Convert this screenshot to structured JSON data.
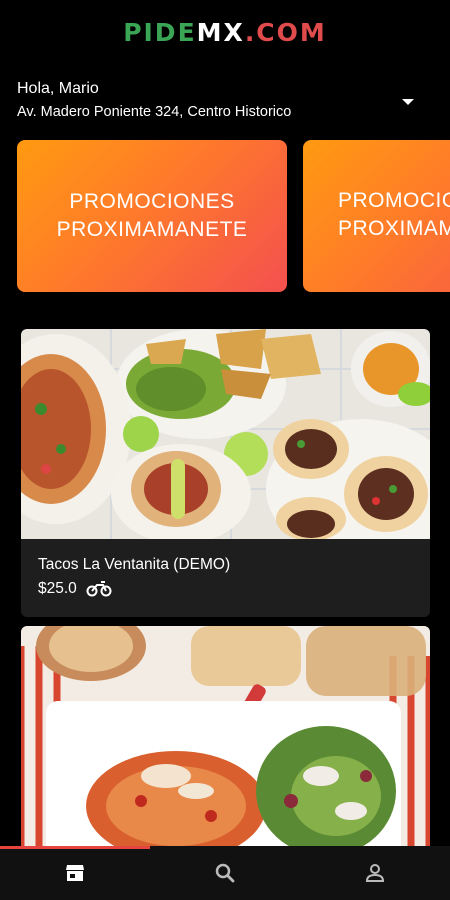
{
  "header": {
    "logo_part1": "PIDE",
    "logo_part2": "MX",
    "logo_part3": ".COM",
    "greeting": "Hola, Mario",
    "address": "Av. Madero Poniente 324, Centro Historico",
    "address_dropdown_icon": "caret-down-icon"
  },
  "promotions": [
    {
      "line1": "PROMOCIONES",
      "line2": "PROXIMAMANETE"
    },
    {
      "line1": "PROMOCIONES",
      "line2": "PROXIMAMANETE"
    }
  ],
  "restaurants": [
    {
      "name": "Tacos La Ventanita (DEMO)",
      "price": "$25.0",
      "delivery_icon": "motorcycle-icon",
      "image": "tacos-photo"
    },
    {
      "name": "",
      "price": "",
      "image": "pasta-photo"
    }
  ],
  "bottom_nav": {
    "items": [
      {
        "icon": "store-icon",
        "active": true
      },
      {
        "icon": "search-icon",
        "active": false
      },
      {
        "icon": "profile-icon",
        "active": false
      }
    ]
  },
  "colors": {
    "background": "#000000",
    "logo_green": "#3aa655",
    "logo_red": "#e04b4b",
    "promo_gradient_start": "#ff9a10",
    "promo_gradient_end": "#f3504f",
    "card_background": "#1e1e1e",
    "nav_indicator": "#e6453f"
  }
}
